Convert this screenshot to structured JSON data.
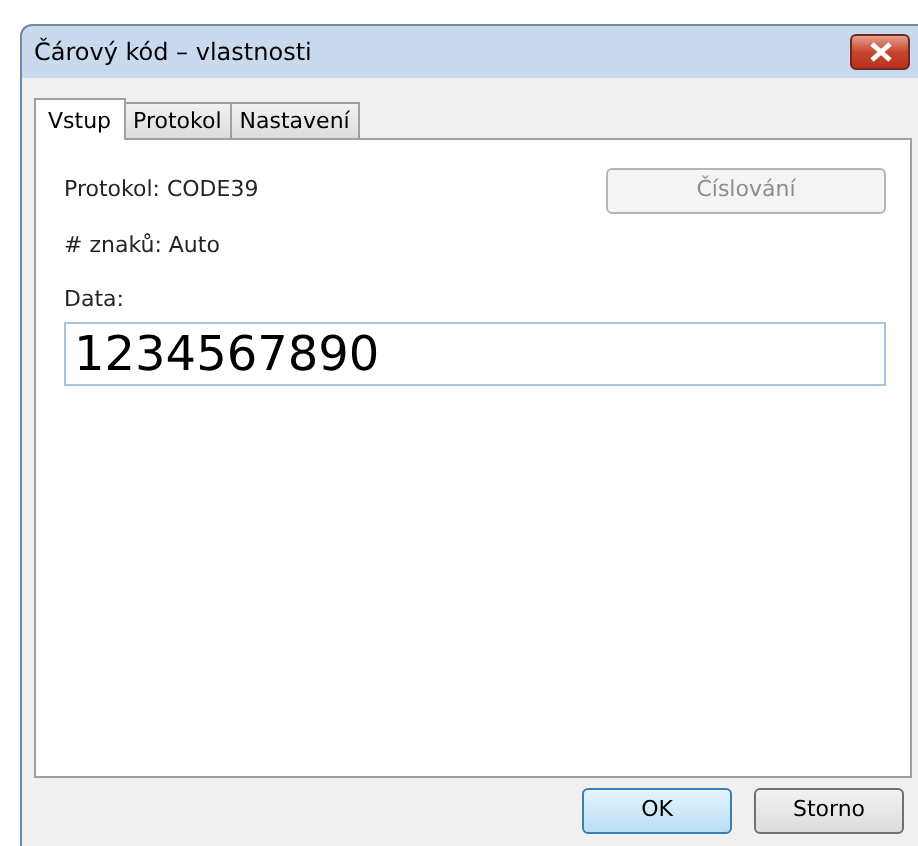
{
  "window": {
    "title": "Čárový kód – vlastnosti"
  },
  "tabs": [
    {
      "label": "Vstup",
      "selected": true
    },
    {
      "label": "Protokol",
      "selected": false
    },
    {
      "label": "Nastavení",
      "selected": false
    }
  ],
  "protocol_text": "Protokol: CODE39",
  "char_count_text": "# znaků: Auto",
  "numbering_button": {
    "label": "Číslování",
    "disabled": true
  },
  "data_field": {
    "label": "Data:",
    "value": "1234567890"
  },
  "buttons": [
    {
      "label": "OK",
      "default": true
    },
    {
      "label": "Storno",
      "default": false
    }
  ]
}
